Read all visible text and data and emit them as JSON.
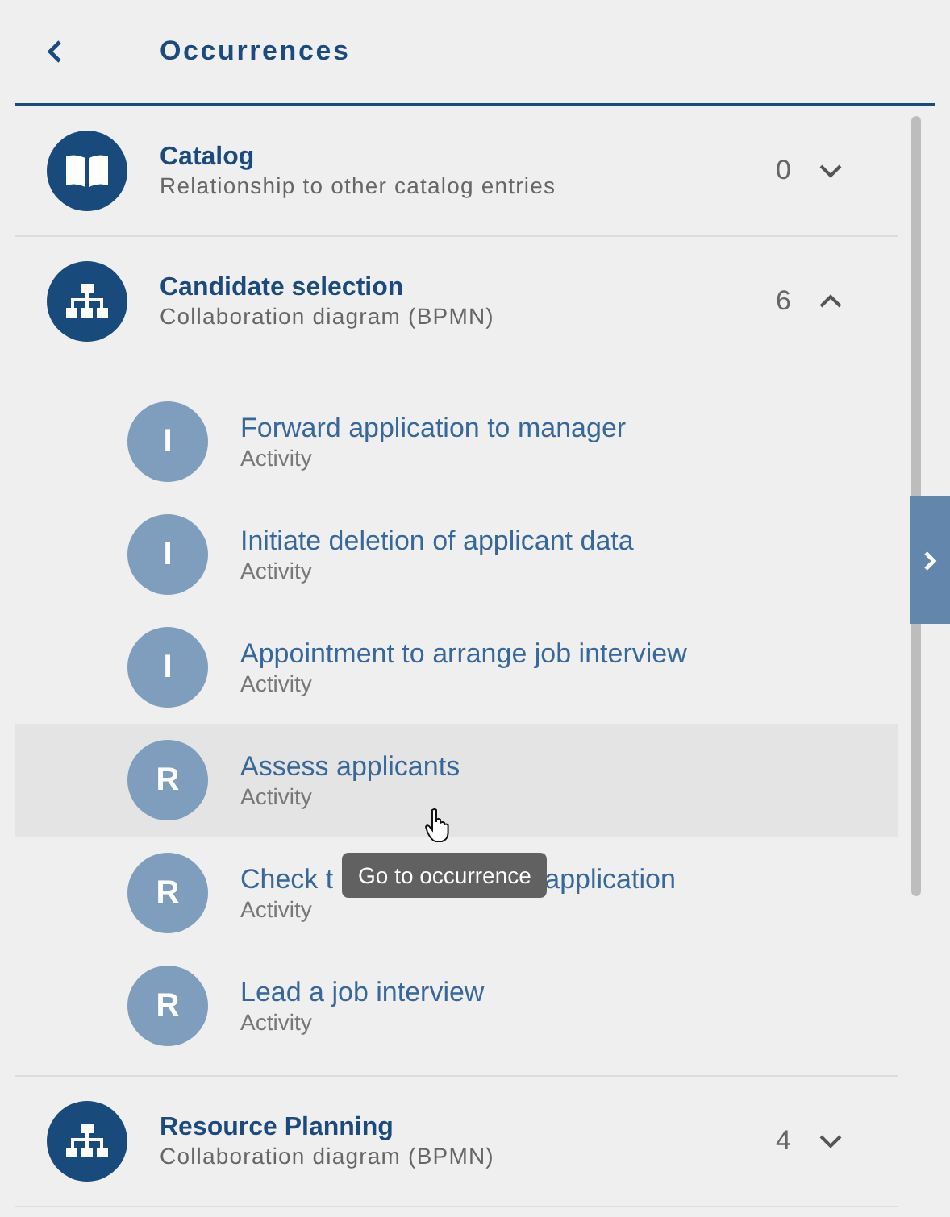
{
  "header": {
    "title": "Occurrences"
  },
  "groups": [
    {
      "kind": "catalog",
      "title": "Catalog",
      "subtitle": "Relationship to other catalog entries",
      "count": "0",
      "expanded": false
    },
    {
      "kind": "diagram",
      "title": "Candidate selection",
      "subtitle": "Collaboration diagram (BPMN)",
      "count": "6",
      "expanded": true,
      "items": [
        {
          "letter": "I",
          "title": "Forward application to manager",
          "subtitle": "Activity",
          "hovered": false
        },
        {
          "letter": "I",
          "title": "Initiate deletion of applicant data",
          "subtitle": "Activity",
          "hovered": false
        },
        {
          "letter": "I",
          "title": "Appointment to arrange job interview",
          "subtitle": "Activity",
          "hovered": false
        },
        {
          "letter": "R",
          "title": "Assess applicants",
          "subtitle": "Activity",
          "hovered": true,
          "tooltip": "Go to occurrence"
        },
        {
          "letter": "R",
          "title": "Check t",
          "title_end": "application",
          "subtitle": "Activity",
          "hovered": false
        },
        {
          "letter": "R",
          "title": "Lead a job interview",
          "subtitle": "Activity",
          "hovered": false
        }
      ]
    },
    {
      "kind": "diagram",
      "title": "Resource Planning",
      "subtitle": "Collaboration diagram (BPMN)",
      "count": "4",
      "expanded": false
    }
  ]
}
